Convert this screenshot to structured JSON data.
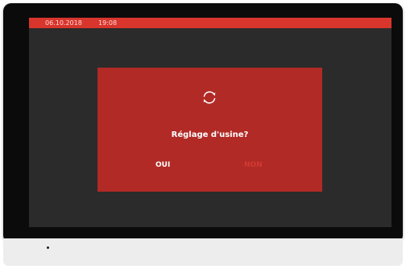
{
  "status_bar": {
    "date": "06.10.2018",
    "time": "19:08",
    "color": "#d8352c"
  },
  "dialog": {
    "icon": "refresh-icon",
    "title": "Réglage d'usine?",
    "buttons": {
      "yes_label": "OUI",
      "no_label": "NON"
    },
    "background_color": "#b12a26"
  },
  "screen": {
    "background_color": "#2b2b2b"
  }
}
